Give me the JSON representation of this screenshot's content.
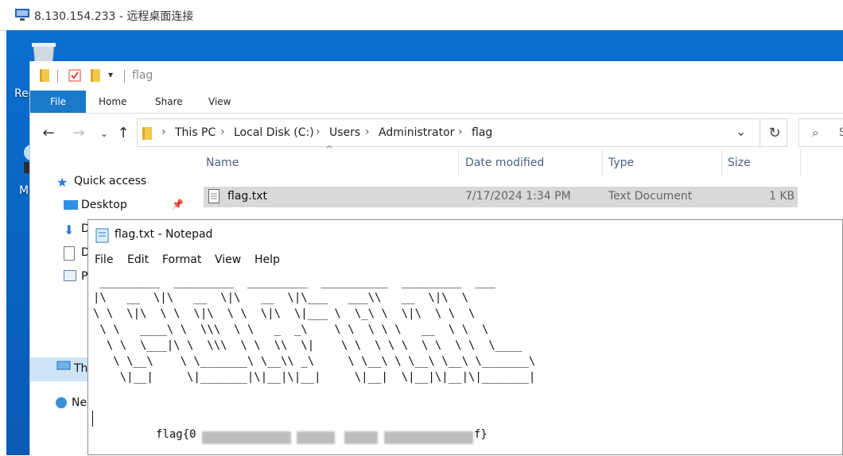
{
  "rdp": {
    "title": "8.130.154.233 - 远程桌面连接"
  },
  "desktop": {
    "labels": [
      "Rec",
      "M"
    ]
  },
  "explorer": {
    "qa_path": "flag",
    "tabs": {
      "file": "File",
      "home": "Home",
      "share": "Share",
      "view": "View"
    },
    "breadcrumb": [
      "This PC",
      "Local Disk (C:)",
      "Users",
      "Administrator",
      "flag"
    ],
    "sidebar": {
      "quick_access": "Quick access",
      "items": [
        "Desktop",
        "D",
        "D",
        "P",
        "Thi",
        "Ne"
      ]
    },
    "columns": {
      "name": "Name",
      "date": "Date modified",
      "type": "Type",
      "size": "Size"
    },
    "files": [
      {
        "name": "flag.txt",
        "date": "7/17/2024 1:34 PM",
        "type": "Text Document",
        "size": "1 KB"
      }
    ]
  },
  "notepad": {
    "title": "flag.txt - Notepad",
    "menu": [
      "File",
      "Edit",
      "Format",
      "View",
      "Help"
    ],
    "ascii_art": " _________  _________  _________  __________  _________  ___\n|\\   __  \\|\\   __  \\|\\   __  \\|\\___   ___\\\\   __  \\|\\  \\\n\\ \\  \\|\\  \\ \\  \\|\\  \\ \\  \\|\\  \\|___ \\  \\_\\ \\  \\|\\  \\ \\  \\\n \\ \\   ____\\ \\  \\\\\\  \\ \\   _  _\\    \\ \\  \\ \\ \\   __  \\ \\  \\\n  \\ \\  \\___|\\ \\  \\\\\\  \\ \\  \\\\  \\|    \\ \\  \\ \\ \\  \\ \\  \\ \\  \\____\n   \\ \\__\\    \\ \\_______\\ \\__\\\\ _\\     \\ \\__\\ \\ \\__\\ \\__\\ \\_______\\\n    \\|__|     \\|_______|\\|__|\\|__|     \\|__|  \\|__|\\|__|\\|_______|",
    "flag_prefix": "flag{0",
    "flag_suffix": "f}"
  }
}
